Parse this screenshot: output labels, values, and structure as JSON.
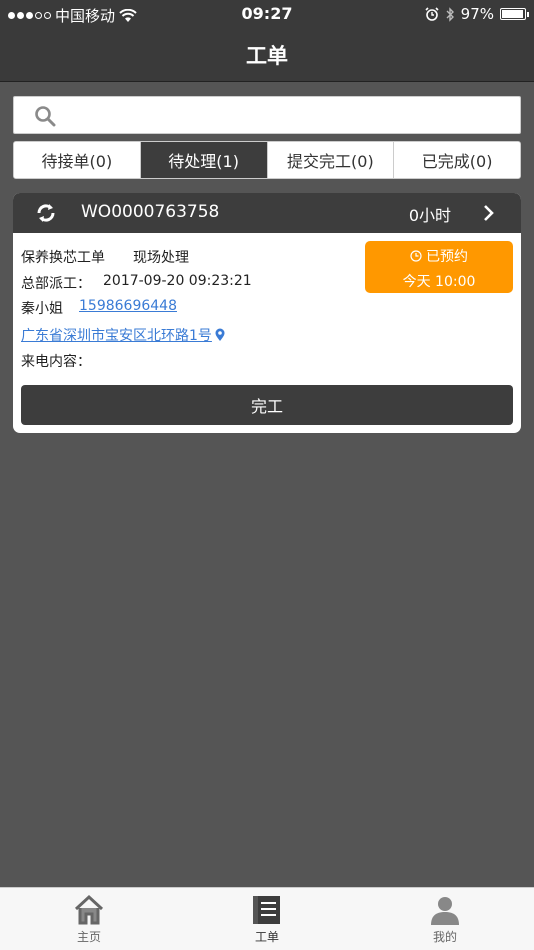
{
  "status_bar": {
    "carrier": "中国移动",
    "time": "09:27",
    "battery": "97%",
    "battery_level": 0.97
  },
  "nav": {
    "title": "工单"
  },
  "search": {
    "value": "",
    "placeholder": ""
  },
  "tabs": [
    {
      "label": "待接单(0)",
      "active": false
    },
    {
      "label": "待处理(1)",
      "active": true
    },
    {
      "label": "提交完工(0)",
      "active": false
    },
    {
      "label": "已完成(0)",
      "active": false
    }
  ],
  "order": {
    "order_no": "WO0000763758",
    "hours": "0小时",
    "type": "保养换芯工单",
    "service": "现场处理",
    "dispatch_label": "总部派工：",
    "dispatch_time": "2017-09-20 09:23:21",
    "contact_name": "秦小姐",
    "phone": "15986696448",
    "address": "广东省深圳市宝安区北环路1号",
    "call_content_label": "来电内容：",
    "badge_status": "已预约",
    "badge_time": "今天 10:00",
    "finish_label": "完工"
  },
  "tabbar": [
    {
      "label": "主页",
      "icon": "home-icon"
    },
    {
      "label": "工单",
      "icon": "document-icon"
    },
    {
      "label": "我的",
      "icon": "user-icon"
    }
  ],
  "colors": {
    "background": "#555555",
    "header": "#3d3d3d",
    "accent": "#ff9800",
    "link": "#3a7bd5"
  }
}
